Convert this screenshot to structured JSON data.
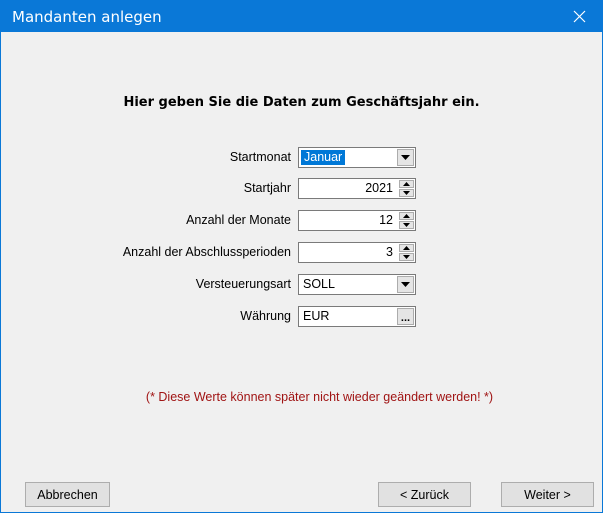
{
  "window": {
    "title": "Mandanten anlegen",
    "close_glyph": "✕"
  },
  "heading": "Hier geben Sie die Daten zum Geschäftsjahr ein.",
  "fields": {
    "startmonat": {
      "label": "Startmonat",
      "value": "Januar"
    },
    "startjahr": {
      "label": "Startjahr",
      "value": "2021"
    },
    "anzahl_monate": {
      "label": "Anzahl der Monate",
      "value": "12"
    },
    "abschlussperioden": {
      "label": "Anzahl der Abschlussperioden",
      "value": "3"
    },
    "versteuerungsart": {
      "label": "Versteuerungsart",
      "value": "SOLL"
    },
    "waehrung": {
      "label": "Währung",
      "value": "EUR",
      "browse_label": "..."
    }
  },
  "note": "(* Diese Werte können später nicht wieder geändert werden! *)",
  "buttons": {
    "abbrechen": "Abbrechen",
    "zurueck": "< Zurück",
    "weiter": "Weiter >"
  },
  "colors": {
    "titlebar": "#0a78d7",
    "selection": "#0078d7",
    "note": "#a01414"
  }
}
